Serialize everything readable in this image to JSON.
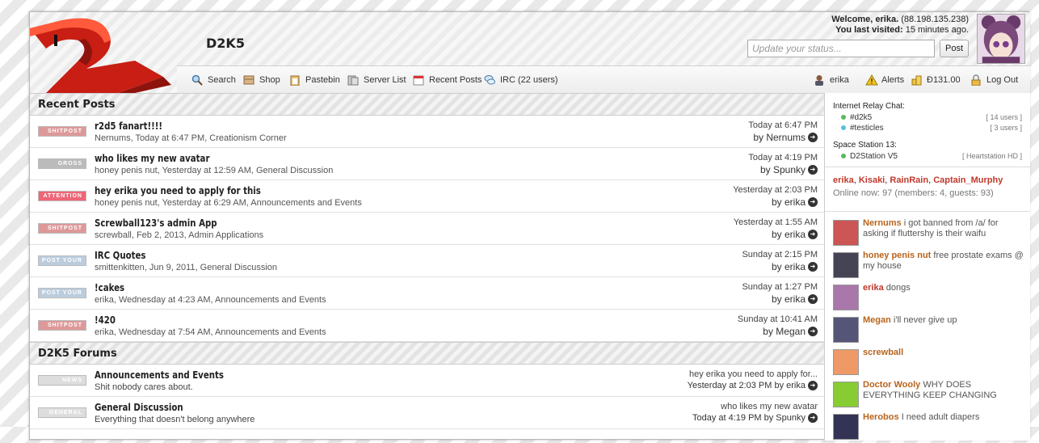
{
  "site": {
    "title": "D2K5"
  },
  "user": {
    "welcome": "Welcome, erika.",
    "ip": "(88.198.135.238)",
    "last_label": "You last visited:",
    "last_value": "15 minutes ago."
  },
  "status": {
    "placeholder": "Update your status...",
    "post_label": "Post"
  },
  "nav": {
    "left": [
      "Search",
      "Shop",
      "Pastebin",
      "Server List",
      "Recent Posts",
      "IRC (22 users)"
    ],
    "right": [
      "erika",
      "Alerts",
      "Đ131.00",
      "Log Out"
    ]
  },
  "recent": {
    "title": "Recent Posts",
    "rows": [
      {
        "badge": "SHITPOST",
        "title": "r2d5 fanart!!!!",
        "sub": "Nernums, Today at 6:47 PM, Creationism Corner",
        "date": "Today at 6:47 PM",
        "by": "by Nernums"
      },
      {
        "badge": "GROSS",
        "title": "who likes my new avatar",
        "sub": "honey penis nut, Yesterday at 12:59 AM, General Discussion",
        "date": "Today at 4:19 PM",
        "by": "by Spunky"
      },
      {
        "badge": "ATTENTION",
        "title": "hey erika you need to apply for this",
        "sub": "honey penis nut, Yesterday at 6:29 AM, Announcements and Events",
        "date": "Yesterday at 2:03 PM",
        "by": "by erika"
      },
      {
        "badge": "SHITPOST",
        "title": "Screwball123's admin App",
        "sub": "screwball, Feb 2, 2013, Admin Applications",
        "date": "Yesterday at 1:55 AM",
        "by": "by erika"
      },
      {
        "badge": "POST YOUR",
        "title": "IRC Quotes",
        "sub": "smittenkitten, Jun 9, 2011, General Discussion",
        "date": "Sunday at 2:15 PM",
        "by": "by erika"
      },
      {
        "badge": "POST YOUR",
        "title": "!cakes",
        "sub": "erika, Wednesday at 4:23 AM, Announcements and Events",
        "date": "Sunday at 1:27 PM",
        "by": "by erika"
      },
      {
        "badge": "SHITPOST",
        "title": "!420",
        "sub": "erika, Wednesday at 7:54 AM, Announcements and Events",
        "date": "Sunday at 10:41 AM",
        "by": "by Megan"
      }
    ]
  },
  "forums": {
    "title": "D2K5 Forums",
    "rows": [
      {
        "badge": "NEWS",
        "title": "Announcements and Events",
        "sub": "Shit nobody cares about.",
        "last": "hey erika you need to apply for...",
        "by": "Yesterday at 2:03 PM by erika"
      },
      {
        "badge": "GENERAL",
        "title": "General Discussion",
        "sub": "Everything that doesn't belong anywhere",
        "last": "who likes my new avatar",
        "by": "Today at 4:19 PM by Spunky"
      }
    ]
  },
  "irc": {
    "label": "Internet Relay Chat:",
    "channels": [
      {
        "name": "#d2k5",
        "count": "[ 14 users ]",
        "color": "#5cb85c"
      },
      {
        "name": "#testicles",
        "count": "[ 3 users ]",
        "color": "#5bc0de"
      }
    ]
  },
  "ss13": {
    "label": "Space Station 13:",
    "servers": [
      {
        "name": "D2Station V5",
        "status": "[ Heartstation HD ]",
        "color": "#5cb85c"
      }
    ]
  },
  "online": {
    "names": [
      "erika",
      "Kisaki",
      "RainRain",
      "Captain_Murphy"
    ],
    "summary": "Online now: 97 (members: 4, guests: 93)"
  },
  "shouts": [
    {
      "who": "Nernums",
      "text": "i got banned from /a/ for asking if fluttershy is their waifu",
      "red": false,
      "avatar": "#c55"
    },
    {
      "who": "honey penis nut",
      "text": "free prostate exams @ my house",
      "red": false,
      "avatar": "#445"
    },
    {
      "who": "erika",
      "text": "dongs",
      "red": true,
      "avatar": "#a7a"
    },
    {
      "who": "Megan",
      "text": "i'll never give up",
      "red": false,
      "avatar": "#557"
    },
    {
      "who": "screwball",
      "text": "",
      "red": false,
      "avatar": "#e96"
    },
    {
      "who": "Doctor Wooly",
      "text": "WHY DOES EVERYTHING KEEP CHANGING",
      "red": false,
      "avatar": "#8c3"
    },
    {
      "who": "Herobos",
      "text": "I need adult diapers",
      "red": false,
      "avatar": "#335"
    }
  ],
  "colors": {
    "accent_red": "#c0392b",
    "shout_name": "#b8641c"
  }
}
